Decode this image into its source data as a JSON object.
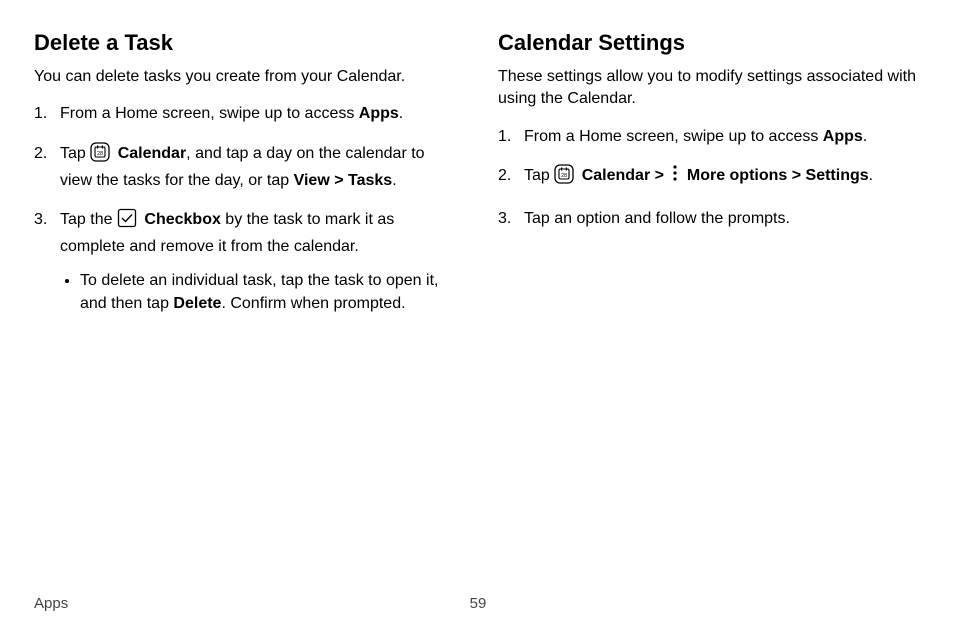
{
  "left": {
    "heading": "Delete a Task",
    "intro": "You can delete tasks you create from your Calendar.",
    "step1_a": "From a Home screen, swipe up to access ",
    "step1_b": "Apps",
    "step1_c": ".",
    "step2_a": "Tap ",
    "step2_b": "Calendar",
    "step2_c": ", and tap a day on the calendar to view the tasks for the day, or tap ",
    "step2_d": "View",
    "gt": " > ",
    "step2_e": "Tasks",
    "step2_f": ".",
    "step3_a": "Tap the ",
    "step3_b": "Checkbox",
    "step3_c": " by the task to mark it as complete and remove it from the calendar.",
    "bullet_a": "To delete an individual task, tap the task to open it, and then tap ",
    "bullet_b": "Delete",
    "bullet_c": ". Confirm when prompted."
  },
  "right": {
    "heading": "Calendar Settings",
    "intro": "These settings allow you to modify settings associated with using the Calendar.",
    "step1_a": "From a Home screen, swipe up to access ",
    "step1_b": "Apps",
    "step1_c": ".",
    "step2_a": "Tap ",
    "step2_b": "Calendar",
    "gt": " > ",
    "step2_c": "More options",
    "step2_d": "Settings",
    "step2_e": ".",
    "step3": "Tap an option and follow the prompts."
  },
  "footer": {
    "section": "Apps",
    "page": "59"
  }
}
